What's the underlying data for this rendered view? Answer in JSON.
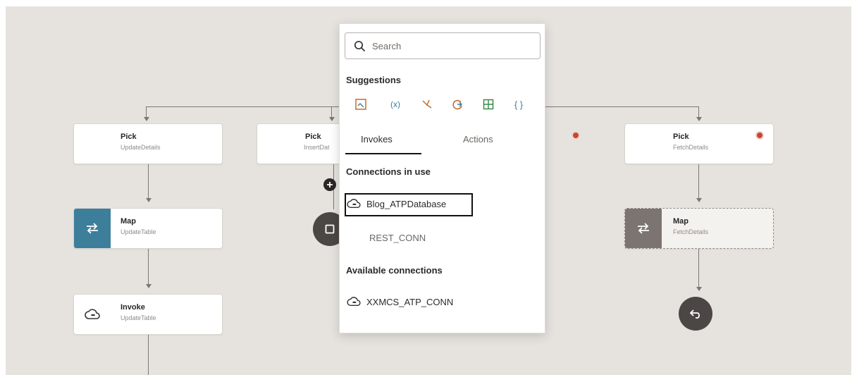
{
  "colors": {
    "canvas": "#e6e3df",
    "map_teal": "#3d7e9a",
    "map_gray": "#7c7470",
    "node_dark": "#4c4744",
    "error_red": "#c74634"
  },
  "flow": {
    "col1": {
      "pick": {
        "title": "Pick",
        "subtitle": "UpdateDetails"
      },
      "map": {
        "title": "Map",
        "subtitle": "UpdateTable"
      },
      "invoke": {
        "title": "Invoke",
        "subtitle": "UpdateTable"
      }
    },
    "col2": {
      "pick": {
        "title": "Pick",
        "subtitle": "InsertDat"
      }
    },
    "col4": {
      "pick": {
        "title": "Pick",
        "subtitle": "FetchDetails"
      },
      "map": {
        "title": "Map",
        "subtitle": "FetchDetails"
      }
    }
  },
  "popup": {
    "search_placeholder": "Search",
    "suggestions_title": "Suggestions",
    "suggestion_icons": [
      "map-icon",
      "variable-icon",
      "branch-icon",
      "loop-icon",
      "table-icon",
      "json-icon"
    ],
    "tabs": [
      {
        "label": "Invokes",
        "active": true
      },
      {
        "label": "Actions",
        "active": false
      }
    ],
    "connections_in_use_title": "Connections in use",
    "connections_in_use": [
      "Blog_ATPDatabase",
      "REST_CONN"
    ],
    "available_title": "Available connections",
    "available_connections": [
      "XXMCS_ATP_CONN"
    ]
  }
}
